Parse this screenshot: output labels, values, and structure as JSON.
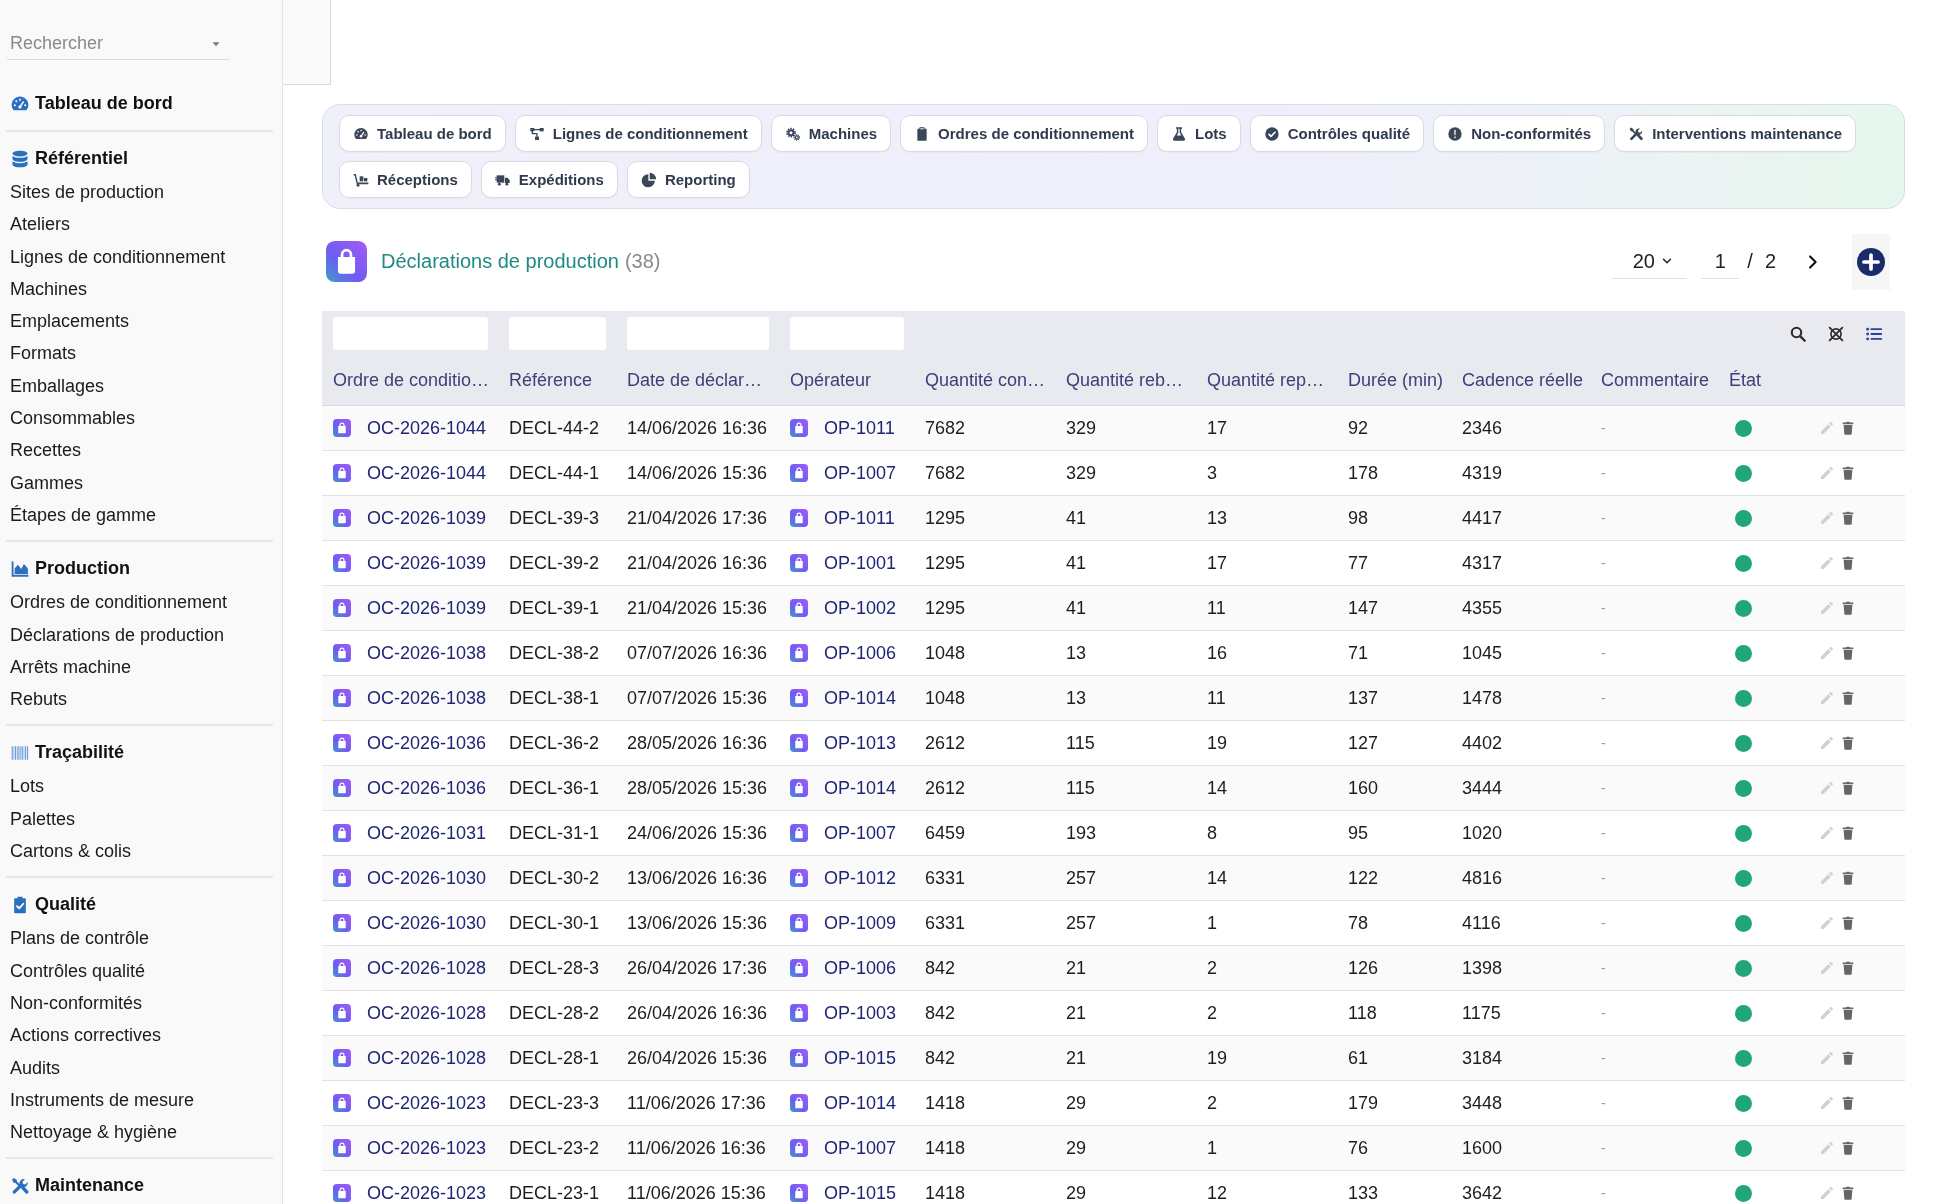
{
  "sidebar": {
    "search": {
      "placeholder": "Rechercher"
    },
    "sections": [
      {
        "title": "Tableau de bord"
      },
      {
        "title": "Référentiel",
        "items": [
          {
            "label": "Sites de production",
            "selected": false
          },
          {
            "label": "Ateliers",
            "selected": false
          },
          {
            "label": "Lignes de conditionnement",
            "selected": false
          },
          {
            "label": "Machines",
            "selected": false
          },
          {
            "label": "Emplacements",
            "selected": false
          },
          {
            "label": "Formats",
            "selected": false
          },
          {
            "label": "Emballages",
            "selected": false
          },
          {
            "label": "Consommables",
            "selected": false
          },
          {
            "label": "Recettes",
            "selected": false
          },
          {
            "label": "Gammes",
            "selected": false
          },
          {
            "label": "Étapes de gamme",
            "selected": false
          }
        ]
      },
      {
        "title": "Production",
        "items": [
          {
            "label": "Ordres de conditionnement",
            "selected": false
          },
          {
            "label": "Déclarations de production",
            "selected": false
          },
          {
            "label": "Arrêts machine",
            "selected": false
          },
          {
            "label": "Rebuts",
            "selected": false
          }
        ]
      },
      {
        "title": "Traçabilité",
        "items": [
          {
            "label": "Lots",
            "selected": false
          },
          {
            "label": "Palettes",
            "selected": false
          },
          {
            "label": "Cartons & colis",
            "selected": false
          }
        ]
      },
      {
        "title": "Qualité",
        "items": [
          {
            "label": "Plans de contrôle",
            "selected": false
          },
          {
            "label": "Contrôles qualité",
            "selected": false
          },
          {
            "label": "Non-conformités",
            "selected": false
          },
          {
            "label": "Actions correctives",
            "selected": false
          },
          {
            "label": "Audits",
            "selected": false
          },
          {
            "label": "Instruments de mesure",
            "selected": false
          },
          {
            "label": "Nettoyage & hygiène",
            "selected": false
          }
        ]
      },
      {
        "title": "Maintenance"
      }
    ]
  },
  "nav_tabs": [
    {
      "label": "Tableau de bord",
      "selected": false
    },
    {
      "label": "Lignes de conditionnement",
      "selected": false
    },
    {
      "label": "Machines",
      "selected": false
    },
    {
      "label": "Ordres de conditionnement",
      "selected": false
    },
    {
      "label": "Lots",
      "selected": false
    },
    {
      "label": "Contrôles qualité",
      "selected": false
    },
    {
      "label": "Non-conformités",
      "selected": false
    },
    {
      "label": "Interventions maintenance",
      "selected": false
    },
    {
      "label": "Réceptions",
      "selected": false
    },
    {
      "label": "Expéditions",
      "selected": false
    },
    {
      "label": "Reporting",
      "selected": false
    }
  ],
  "page": {
    "title": "Déclarations de production",
    "count": "(38)"
  },
  "pagination": {
    "page_size": "20",
    "current_page": "1",
    "separator": "/",
    "total_pages": "2"
  },
  "table": {
    "columns": [
      {
        "label": "Ordre de conditio…",
        "kind": "order_link",
        "filterable": true
      },
      {
        "label": "Référence",
        "kind": "text",
        "filterable": true
      },
      {
        "label": "Date de déclar…",
        "kind": "text",
        "filterable": true
      },
      {
        "label": "Opérateur",
        "kind": "operator_link",
        "filterable": true
      },
      {
        "label": "Quantité con…",
        "kind": "text",
        "filterable": false
      },
      {
        "label": "Quantité reb…",
        "kind": "text",
        "filterable": false
      },
      {
        "label": "Quantité rep…",
        "kind": "text",
        "filterable": false
      },
      {
        "label": "Durée (min)",
        "kind": "text",
        "filterable": false
      },
      {
        "label": "Cadence réelle",
        "kind": "text",
        "filterable": false
      },
      {
        "label": "Commentaire",
        "kind": "muted",
        "filterable": false
      },
      {
        "label": "État",
        "kind": "status",
        "filterable": false
      }
    ],
    "rows": [
      {
        "cells": [
          "OC-2026-1044",
          "DECL-44-2",
          "14/06/2026 16:36",
          "OP-1011",
          "7682",
          "329",
          "17",
          "92",
          "2346",
          "-"
        ],
        "color": "#21a67a"
      },
      {
        "cells": [
          "OC-2026-1044",
          "DECL-44-1",
          "14/06/2026 15:36",
          "OP-1007",
          "7682",
          "329",
          "3",
          "178",
          "4319",
          "-"
        ],
        "color": "#21a67a"
      },
      {
        "cells": [
          "OC-2026-1039",
          "DECL-39-3",
          "21/04/2026 17:36",
          "OP-1011",
          "1295",
          "41",
          "13",
          "98",
          "4417",
          "-"
        ],
        "color": "#21a67a"
      },
      {
        "cells": [
          "OC-2026-1039",
          "DECL-39-2",
          "21/04/2026 16:36",
          "OP-1001",
          "1295",
          "41",
          "17",
          "77",
          "4317",
          "-"
        ],
        "color": "#21a67a"
      },
      {
        "cells": [
          "OC-2026-1039",
          "DECL-39-1",
          "21/04/2026 15:36",
          "OP-1002",
          "1295",
          "41",
          "11",
          "147",
          "4355",
          "-"
        ],
        "color": "#21a67a"
      },
      {
        "cells": [
          "OC-2026-1038",
          "DECL-38-2",
          "07/07/2026 16:36",
          "OP-1006",
          "1048",
          "13",
          "16",
          "71",
          "1045",
          "-"
        ],
        "color": "#21a67a"
      },
      {
        "cells": [
          "OC-2026-1038",
          "DECL-38-1",
          "07/07/2026 15:36",
          "OP-1014",
          "1048",
          "13",
          "11",
          "137",
          "1478",
          "-"
        ],
        "color": "#21a67a"
      },
      {
        "cells": [
          "OC-2026-1036",
          "DECL-36-2",
          "28/05/2026 16:36",
          "OP-1013",
          "2612",
          "115",
          "19",
          "127",
          "4402",
          "-"
        ],
        "color": "#21a67a"
      },
      {
        "cells": [
          "OC-2026-1036",
          "DECL-36-1",
          "28/05/2026 15:36",
          "OP-1014",
          "2612",
          "115",
          "14",
          "160",
          "3444",
          "-"
        ],
        "color": "#21a67a"
      },
      {
        "cells": [
          "OC-2026-1031",
          "DECL-31-1",
          "24/06/2026 15:36",
          "OP-1007",
          "6459",
          "193",
          "8",
          "95",
          "1020",
          "-"
        ],
        "color": "#21a67a"
      },
      {
        "cells": [
          "OC-2026-1030",
          "DECL-30-2",
          "13/06/2026 16:36",
          "OP-1012",
          "6331",
          "257",
          "14",
          "122",
          "4816",
          "-"
        ],
        "color": "#21a67a"
      },
      {
        "cells": [
          "OC-2026-1030",
          "DECL-30-1",
          "13/06/2026 15:36",
          "OP-1009",
          "6331",
          "257",
          "1",
          "78",
          "4116",
          "-"
        ],
        "color": "#21a67a"
      },
      {
        "cells": [
          "OC-2026-1028",
          "DECL-28-3",
          "26/04/2026 17:36",
          "OP-1006",
          "842",
          "21",
          "2",
          "126",
          "1398",
          "-"
        ],
        "color": "#21a67a"
      },
      {
        "cells": [
          "OC-2026-1028",
          "DECL-28-2",
          "26/04/2026 16:36",
          "OP-1003",
          "842",
          "21",
          "2",
          "118",
          "1175",
          "-"
        ],
        "color": "#21a67a"
      },
      {
        "cells": [
          "OC-2026-1028",
          "DECL-28-1",
          "26/04/2026 15:36",
          "OP-1015",
          "842",
          "21",
          "19",
          "61",
          "3184",
          "-"
        ],
        "color": "#21a67a"
      },
      {
        "cells": [
          "OC-2026-1023",
          "DECL-23-3",
          "11/06/2026 17:36",
          "OP-1014",
          "1418",
          "29",
          "2",
          "179",
          "3448",
          "-"
        ],
        "color": "#21a67a"
      },
      {
        "cells": [
          "OC-2026-1023",
          "DECL-23-2",
          "11/06/2026 16:36",
          "OP-1007",
          "1418",
          "29",
          "1",
          "76",
          "1600",
          "-"
        ],
        "color": "#21a67a"
      },
      {
        "cells": [
          "OC-2026-1023",
          "DECL-23-1",
          "11/06/2026 15:36",
          "OP-1015",
          "1418",
          "29",
          "12",
          "133",
          "3642",
          "-"
        ],
        "color": "#21a67a"
      }
    ]
  }
}
